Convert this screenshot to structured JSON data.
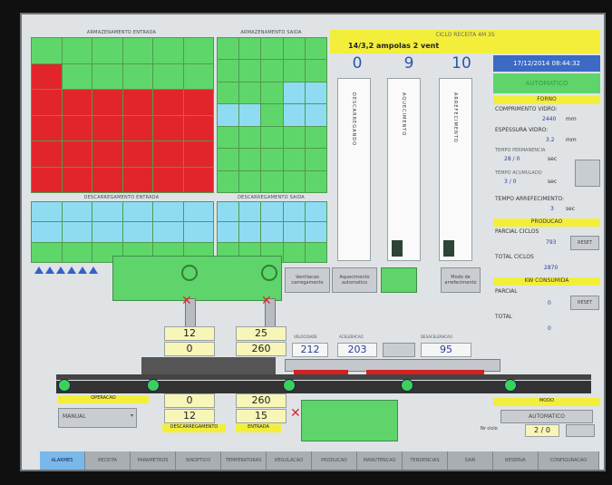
{
  "panels": {
    "top_left_title": "ARMAZENAMENTO ENTRADA",
    "top_mid_title": "ARMAZENAMENTO SAIDA",
    "bottom_left_title": "DESCARREGAMENTO ENTRADA",
    "bottom_mid_title": "DESCARREGAMENTO SAIDA"
  },
  "header": {
    "title": "CICLO RECEITA 4M 3S",
    "recipe": "14/3,2 ampolas 2 vent",
    "date": "17/12/2014 08:44:32",
    "status": "AUTOMATICO"
  },
  "counters": [
    "0",
    "9",
    "10"
  ],
  "tubes": [
    "DESCARREGANDO",
    "AQUECIMENTO",
    "ARREFECIMENTO"
  ],
  "forno": {
    "title": "FORNO",
    "comprimento_label": "COMPRIMENTO VIDRO:",
    "comprimento_value": "2440",
    "comprimento_unit": "mm",
    "espessura_label": "ESPESSURA VIDRO:",
    "espessura_value": "3.2",
    "espessura_unit": "mm",
    "tempo_label1": "TEMPO PERMANENCIA",
    "tempo_value1": "28 / 0",
    "tempo_unit1": "sec",
    "tempo_label2": "TEMPO ACUMULADO",
    "tempo_value2": "3 / 0",
    "tempo_unit2": "sec",
    "tempo_arref_label": "TEMPO ARREFECIMENTO:",
    "tempo_arref_value": "3",
    "tempo_arref_unit": "sec"
  },
  "producao": {
    "title": "PRODUCAO",
    "parcial_label": "PARCIAL CICLOS",
    "parcial_value": "793",
    "total_label": "TOTAL CICLOS",
    "total_value": "2870",
    "reset_label": "RESET"
  },
  "consumida": {
    "title": "KW CONSUMIDA",
    "parcial_label": "PARCIAL",
    "parcial_value": "0",
    "total_label": "TOTAL",
    "total_value": "0",
    "reset_label": "RESET"
  },
  "middle_buttons": [
    "Ventilacao carregamento",
    "Aquecimento automatico",
    "",
    "Modo de arrefecimento"
  ],
  "loading_values": {
    "top1": "12",
    "top2": "25",
    "mid1": "0",
    "mid2": "260",
    "bot1": "0",
    "bot2": "260",
    "bot3": "12",
    "bot4": "15"
  },
  "line_values": {
    "v1_label": "VELOCIDADE",
    "v1": "212",
    "v2_label": "ACELERACAO",
    "v2": "203",
    "v3_label": "DESACELERACAO",
    "v3": "95"
  },
  "bottom_labels": {
    "left_title": "OPERACAO",
    "left_select": "MANUAL",
    "center_left": "DESCARREGAMENTO",
    "center_right": "ENTRADA",
    "status_title": "MODO",
    "status_value": "AUTOMATICO",
    "cycle_label": "Nr ciclo",
    "cycle_value": "2 / 0"
  },
  "nav": [
    "ALARMES",
    "RECEITA",
    "PARAMETROS",
    "SINOPTICO",
    "TEMPERATURAS",
    "REGULACAO",
    "PRODUCAO",
    "MANUTENCAO",
    "TENDENCIAS",
    "SAIR",
    "RESERVA",
    "CONFIGURACAO"
  ]
}
